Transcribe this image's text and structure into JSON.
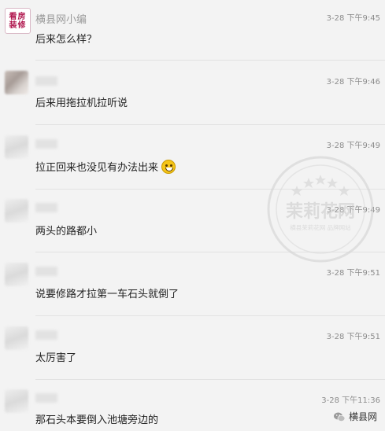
{
  "messages": [
    {
      "avatar": "logo",
      "avatar_text": [
        "看房",
        "装修"
      ],
      "name": "横县网小编",
      "time": "3-28 下午9:45",
      "text": "后来怎么样？"
    },
    {
      "avatar": "blurred",
      "name": "",
      "time": "3-28 下午9:46",
      "text": "后来用拖拉机拉听说"
    },
    {
      "avatar": "blurred",
      "name": "",
      "time": "3-28 下午9:49",
      "text": "拉正回来也没见有办法出来",
      "emoji": "grinning-face-icon"
    },
    {
      "avatar": "blurred",
      "name": "",
      "time": "3-28 下午9:49",
      "text": "两头的路都小"
    },
    {
      "avatar": "blurred",
      "name": "",
      "time": "3-28 下午9:51",
      "text": "说要修路才拉第一车石头就倒了"
    },
    {
      "avatar": "blurred",
      "name": "",
      "time": "3-28 下午9:51",
      "text": "太厉害了"
    },
    {
      "avatar": "blurred",
      "name": "",
      "time": "3-28 下午11:36",
      "text": "那石头本要倒入池塘旁边的"
    }
  ],
  "watermark": {
    "main": "茉莉花网",
    "sub": "横县茉莉花网 品牌网站"
  },
  "footer": {
    "icon": "wechat-icon",
    "label": "横县网"
  },
  "colors": {
    "background": "#f3f3f3",
    "brand": "#b0174e",
    "text": "#222222",
    "meta": "#8c8c8c"
  }
}
